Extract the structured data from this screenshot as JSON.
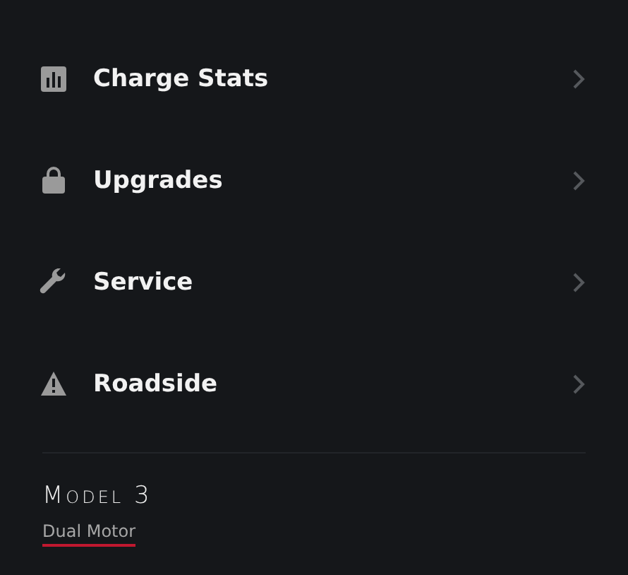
{
  "menu": [
    {
      "kind": "chart",
      "label": "Charge Stats"
    },
    {
      "kind": "bag",
      "label": "Upgrades"
    },
    {
      "kind": "wrench",
      "label": "Service"
    },
    {
      "kind": "warning",
      "label": "Roadside"
    }
  ],
  "vehicle": {
    "model": "Model 3",
    "variant": "Dual Motor"
  }
}
